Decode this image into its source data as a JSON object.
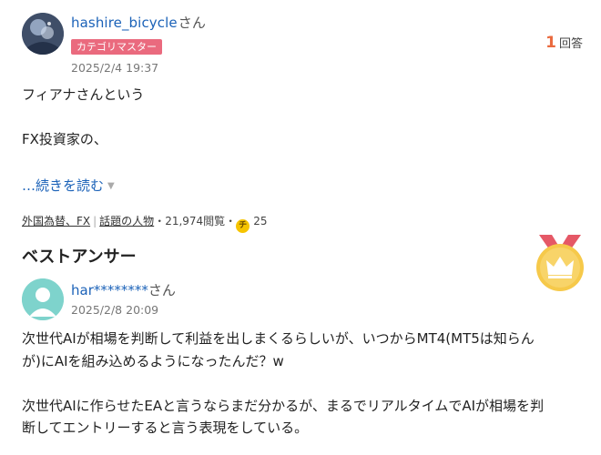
{
  "question": {
    "username": "hashire_bicycle",
    "honorific": "さん",
    "badge": "カテゴリマスター",
    "date": "2025/2/4 19:37",
    "answer_count": "1",
    "answer_count_label": "回答",
    "body_line1": "フィアナさんという",
    "body_line2": "FX投資家の、",
    "read_more": "…続きを読む",
    "category_main": "外国為替、FX",
    "category_sep": "|",
    "category_topic": "話題の人物",
    "views": "・21,974閲覧・",
    "coin_symbol": "チ",
    "coins": "25"
  },
  "best_answer": {
    "title": "ベストアンサー",
    "username": "har********",
    "honorific": "さん",
    "date": "2025/2/8 20:09",
    "para1_line1": "次世代AIが相場を判断して利益を出しまくるらしいが、いつからMT4(MT5は知らん",
    "para1_line2": "が)にAIを組み込めるようになったんだ？w",
    "para2_line1": "次世代AIに作らせたEAと言うならまだ分かるが、まるでリアルタイムでAIが相場を判",
    "para2_line2": "断してエントリーすると言う表現をしている。"
  },
  "colors": {
    "link": "#1b62b8",
    "badge": "#ea6a7e",
    "answer_count": "#ea6a3e",
    "medal": "#f6c94a"
  }
}
